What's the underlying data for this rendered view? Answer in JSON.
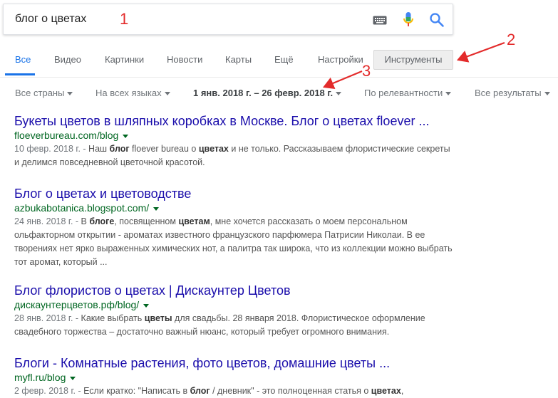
{
  "search": {
    "query": "блог о цветах"
  },
  "tabs": [
    {
      "label": "Все"
    },
    {
      "label": "Видео"
    },
    {
      "label": "Картинки"
    },
    {
      "label": "Новости"
    },
    {
      "label": "Карты"
    },
    {
      "label": "Ещё"
    },
    {
      "label": "Настройки"
    },
    {
      "label": "Инструменты"
    }
  ],
  "filters": [
    {
      "label": "Все страны"
    },
    {
      "label": "На всех языках"
    },
    {
      "label": "1 янв. 2018 г. – 26 февр. 2018 г."
    },
    {
      "label": "По релевантности"
    },
    {
      "label": "Все результаты"
    }
  ],
  "results": [
    {
      "title": "Букеты цветов в шляпных коробках в Москве. Блог о цветах floever ...",
      "url": "floeverbureau.com/blog",
      "date": "10 февр. 2018 г. - ",
      "snippet_html": "Наш <b>блог</b> floever bureau о <b>цветах</b> и не только. Рассказываем флористические секреты и делимся повседневной цветочной красотой."
    },
    {
      "title": "Блог о цветах и цветоводстве",
      "url": "azbukabotanica.blogspot.com/",
      "date": "24 янв. 2018 г. - ",
      "snippet_html": "В <b>блоге</b>, посвященном <b>цветам</b>, мне хочется рассказать о моем персональном ольфакторном открытии - ароматах известного французского парфюмера Патрисии Николаи. В ее творениях нет ярко выраженных химических нот, а палитра так широка, что из коллекции можно выбрать тот аромат, который ..."
    },
    {
      "title": "Блог флористов о цветах | Дискаунтер Цветов",
      "url": "дискаунтерцветов.рф/blog/",
      "date": "28 янв. 2018 г. - ",
      "snippet_html": "Какие выбрать <b>цветы</b> для свадьбы. 28 января 2018. Флористическое оформление свадебного торжества – достаточно важный нюанс, который требует огромного внимания."
    },
    {
      "title": "Блоги - Комнатные растения, фото цветов, домашние цветы ...",
      "url": "myfl.ru/blog",
      "date": "2 февр. 2018 г. - ",
      "snippet_html": "Если кратко: \"Написать в <b>блог</b> / дневник\" - это полноценная статья о <b>цветах</b>,"
    }
  ],
  "annotations": {
    "n1": "1",
    "n2": "2",
    "n3": "3",
    "color": "#e32b2b"
  },
  "colors": {
    "link": "#1a0dab",
    "url": "#006621",
    "accent": "#1a73e8"
  }
}
